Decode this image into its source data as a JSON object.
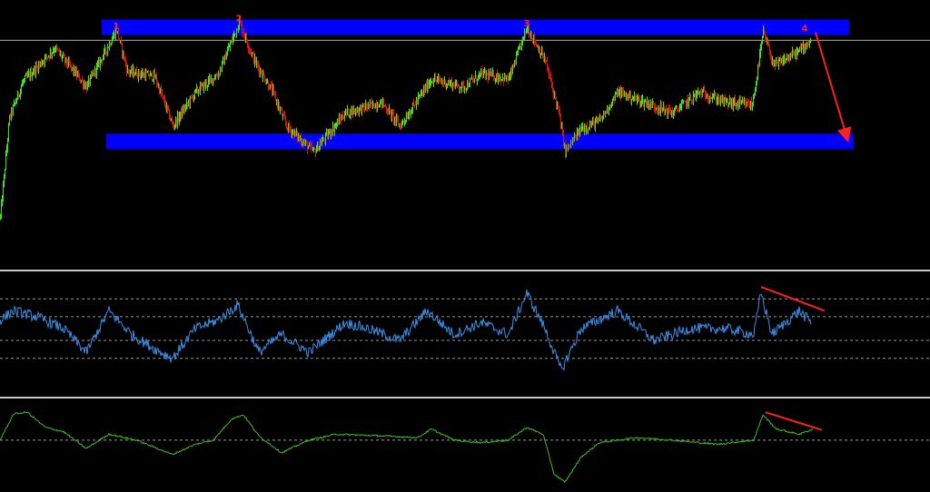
{
  "colors": {
    "background": "#000000",
    "zone": "#0000ff",
    "bull": "#39e61a",
    "bear": "#e01010",
    "price_line": "#a9a9a9",
    "osc1": "#3a8fe8",
    "osc2": "#3fbf1f",
    "annotation": "#ff2020",
    "panel_sep": "#c8c8c8",
    "level_line": "#9a9a9a"
  },
  "chart_data": [
    {
      "type": "candlestick",
      "panel": "price",
      "ylim": [
        0,
        100
      ],
      "x_count": 900,
      "zones": [
        {
          "name": "resistance",
          "x_range": [
            112,
            935
          ],
          "y_range": [
            90,
            96
          ]
        },
        {
          "name": "support",
          "x_range": [
            117,
            940
          ],
          "y_range": [
            46,
            52
          ]
        }
      ],
      "horizontal_line": 88,
      "peaks": [
        {
          "label": "1",
          "x": 128,
          "y": 92
        },
        {
          "label": "2",
          "x": 263,
          "y": 95
        },
        {
          "label": "3",
          "x": 580,
          "y": 93
        },
        {
          "label": "4",
          "x": 886,
          "y": 91
        }
      ],
      "path": [
        [
          0,
          20
        ],
        [
          10,
          58
        ],
        [
          25,
          72
        ],
        [
          60,
          85
        ],
        [
          95,
          70
        ],
        [
          128,
          92
        ],
        [
          140,
          76
        ],
        [
          170,
          74
        ],
        [
          190,
          55
        ],
        [
          215,
          68
        ],
        [
          240,
          75
        ],
        [
          263,
          95
        ],
        [
          280,
          80
        ],
        [
          300,
          68
        ],
        [
          315,
          55
        ],
        [
          345,
          45
        ],
        [
          380,
          60
        ],
        [
          420,
          64
        ],
        [
          440,
          55
        ],
        [
          475,
          73
        ],
        [
          510,
          70
        ],
        [
          530,
          75
        ],
        [
          560,
          73
        ],
        [
          580,
          93
        ],
        [
          600,
          80
        ],
        [
          615,
          60
        ],
        [
          622,
          45
        ],
        [
          640,
          54
        ],
        [
          660,
          57
        ],
        [
          680,
          68
        ],
        [
          710,
          64
        ],
        [
          740,
          60
        ],
        [
          770,
          68
        ],
        [
          800,
          64
        ],
        [
          828,
          63
        ],
        [
          840,
          91
        ],
        [
          852,
          78
        ],
        [
          880,
          84
        ],
        [
          892,
          88
        ]
      ],
      "arrow": {
        "from": [
          898,
          91
        ],
        "to": [
          933,
          50
        ]
      }
    },
    {
      "type": "line",
      "panel": "oscillator-1",
      "ylim": [
        0,
        100
      ],
      "levels": [
        80,
        65,
        45,
        30
      ],
      "path": [
        [
          0,
          62
        ],
        [
          15,
          70
        ],
        [
          40,
          65
        ],
        [
          70,
          55
        ],
        [
          95,
          35
        ],
        [
          120,
          70
        ],
        [
          145,
          50
        ],
        [
          170,
          38
        ],
        [
          190,
          30
        ],
        [
          215,
          55
        ],
        [
          240,
          62
        ],
        [
          262,
          75
        ],
        [
          285,
          35
        ],
        [
          310,
          50
        ],
        [
          340,
          35
        ],
        [
          380,
          60
        ],
        [
          405,
          55
        ],
        [
          440,
          45
        ],
        [
          470,
          70
        ],
        [
          500,
          50
        ],
        [
          530,
          60
        ],
        [
          560,
          50
        ],
        [
          580,
          85
        ],
        [
          600,
          55
        ],
        [
          618,
          20
        ],
        [
          640,
          55
        ],
        [
          680,
          70
        ],
        [
          720,
          45
        ],
        [
          760,
          55
        ],
        [
          800,
          55
        ],
        [
          830,
          50
        ],
        [
          838,
          85
        ],
        [
          850,
          50
        ],
        [
          880,
          70
        ],
        [
          893,
          60
        ]
      ],
      "divergence": {
        "from": [
          838,
          90
        ],
        "to": [
          908,
          70
        ]
      }
    },
    {
      "type": "line",
      "panel": "oscillator-2",
      "ylim": [
        0,
        100
      ],
      "levels": [
        55
      ],
      "path": [
        [
          0,
          55
        ],
        [
          15,
          86
        ],
        [
          30,
          88
        ],
        [
          50,
          70
        ],
        [
          70,
          65
        ],
        [
          95,
          45
        ],
        [
          120,
          62
        ],
        [
          150,
          55
        ],
        [
          190,
          38
        ],
        [
          215,
          50
        ],
        [
          235,
          55
        ],
        [
          255,
          80
        ],
        [
          268,
          85
        ],
        [
          285,
          60
        ],
        [
          310,
          40
        ],
        [
          340,
          55
        ],
        [
          370,
          62
        ],
        [
          420,
          60
        ],
        [
          460,
          58
        ],
        [
          475,
          68
        ],
        [
          500,
          55
        ],
        [
          530,
          52
        ],
        [
          560,
          55
        ],
        [
          580,
          70
        ],
        [
          598,
          62
        ],
        [
          610,
          15
        ],
        [
          622,
          5
        ],
        [
          640,
          35
        ],
        [
          660,
          52
        ],
        [
          700,
          58
        ],
        [
          740,
          55
        ],
        [
          790,
          50
        ],
        [
          830,
          55
        ],
        [
          840,
          85
        ],
        [
          855,
          68
        ],
        [
          880,
          62
        ],
        [
          895,
          68
        ]
      ],
      "divergence": {
        "from": [
          843,
          88
        ],
        "to": [
          905,
          67
        ]
      }
    }
  ]
}
